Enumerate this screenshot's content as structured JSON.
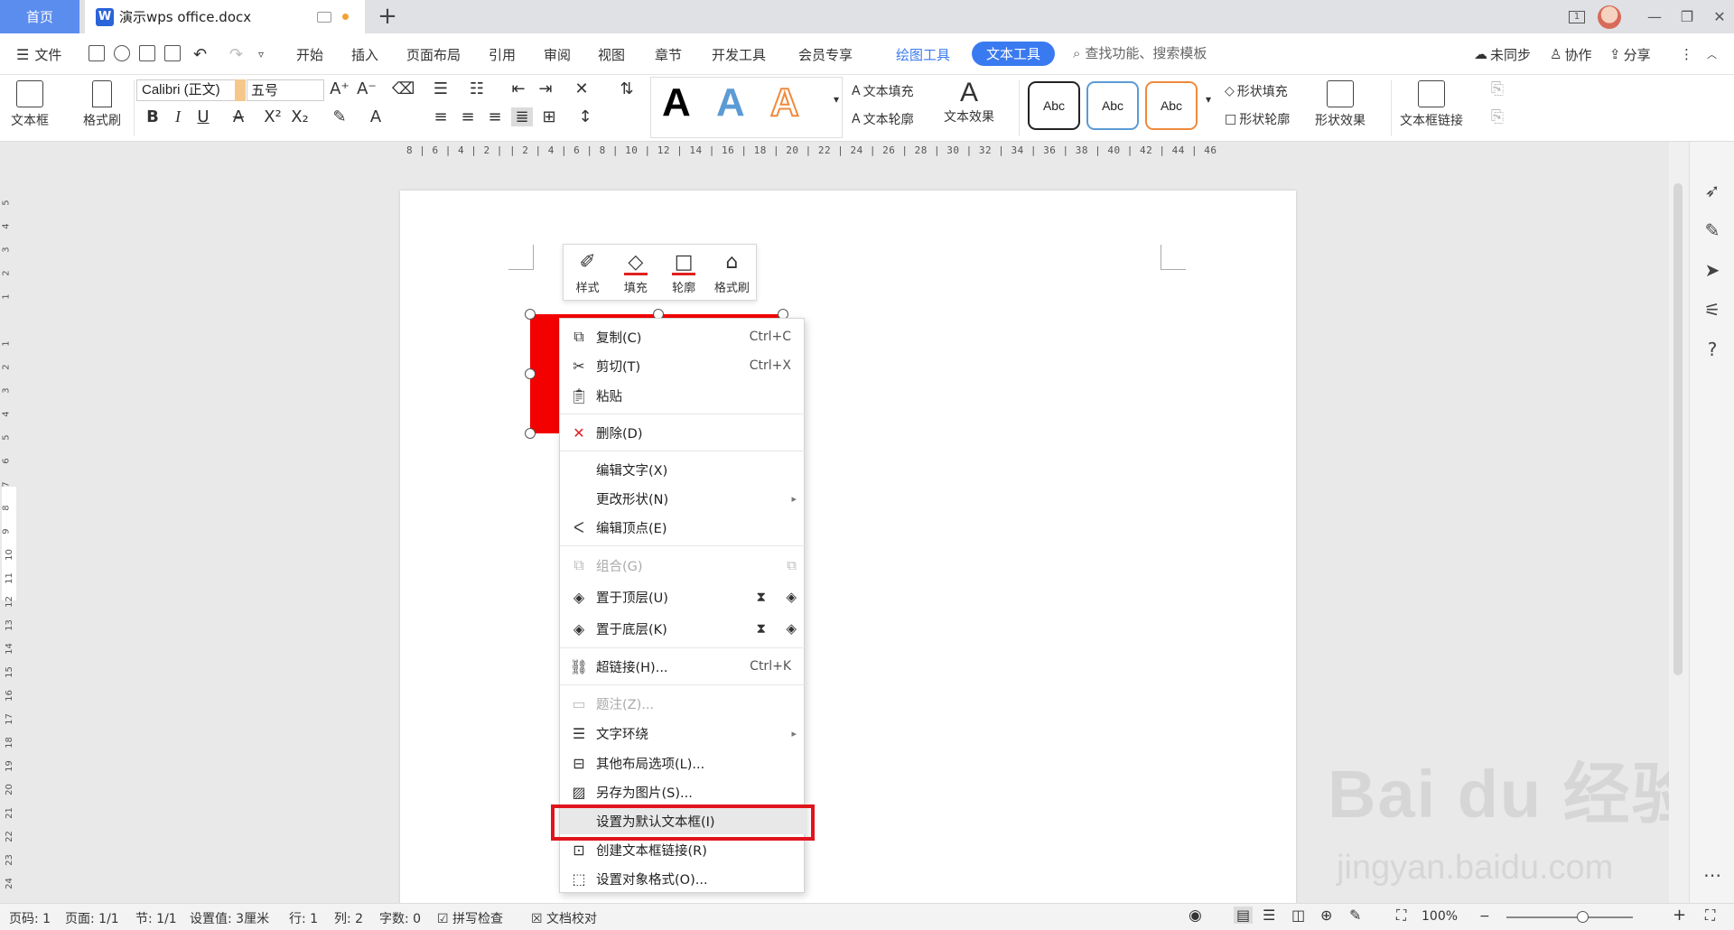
{
  "tabs": {
    "home": "首页",
    "doc_title": "演示wps office.docx"
  },
  "menu": {
    "file": "文件",
    "items": [
      "开始",
      "插入",
      "页面布局",
      "引用",
      "审阅",
      "视图",
      "章节",
      "开发工具",
      "会员专享"
    ],
    "context_tab_drawing": "绘图工具",
    "context_tab_text": "文本工具",
    "search_placeholder": "查找功能、搜索模板",
    "sync": "未同步",
    "collab": "协作",
    "share": "分享"
  },
  "ribbon": {
    "textbox": "文本框",
    "format_painter": "格式刷",
    "font_name": "Calibri (正文)",
    "font_size": "五号",
    "text_fill": "文本填充",
    "text_outline": "文本轮廓",
    "text_effect": "文本效果",
    "abc_label": "Abc",
    "shape_fill": "形状填充",
    "shape_outline": "形状轮廓",
    "shape_effect": "形状效果",
    "textbox_link": "文本框链接"
  },
  "ruler": {
    "ticks": "8 | 6 | 4 | 2 |   | 2 | 4 | 6 | 8 | 10 | 12 | 14 | 16 | 18 | 20 | 22 | 24 | 26 | 28 | 30 | 32 | 34 | 36 | 38 | 40 | 42 | 44 | 46",
    "vertical": [
      "5",
      "4",
      "3",
      "2",
      "1",
      "1",
      "2",
      "3",
      "4",
      "5",
      "6",
      "7",
      "8",
      "9",
      "10",
      "11",
      "12",
      "13",
      "14",
      "15",
      "16",
      "17",
      "18",
      "19",
      "20",
      "21",
      "22",
      "23",
      "24"
    ]
  },
  "mini_toolbar": [
    {
      "label": "样式",
      "icon": "brush-icon"
    },
    {
      "label": "填充",
      "icon": "fill-bucket-icon"
    },
    {
      "label": "轮廓",
      "icon": "outline-icon"
    },
    {
      "label": "格式刷",
      "icon": "format-painter-icon"
    }
  ],
  "context_menu": {
    "copy": "复制(C)",
    "copy_sc": "Ctrl+C",
    "cut": "剪切(T)",
    "cut_sc": "Ctrl+X",
    "paste": "粘贴",
    "delete": "删除(D)",
    "edit_text": "编辑文字(X)",
    "change_shape": "更改形状(N)",
    "edit_points": "编辑顶点(E)",
    "group": "组合(G)",
    "bring_front": "置于顶层(U)",
    "send_back": "置于底层(K)",
    "hyperlink": "超链接(H)...",
    "hyperlink_sc": "Ctrl+K",
    "caption": "题注(Z)...",
    "wrap_text": "文字环绕",
    "layout_options": "其他布局选项(L)...",
    "save_as_picture": "另存为图片(S)...",
    "set_default_textbox": "设置为默认文本框(I)",
    "create_link": "创建文本框链接(R)",
    "format_object": "设置对象格式(O)..."
  },
  "status": {
    "page": "页码: 1",
    "pages": "页面: 1/1",
    "section": "节: 1/1",
    "setting": "设置值: 3厘米",
    "row": "行: 1",
    "col": "列: 2",
    "words": "字数: 0",
    "spell": "拼写检查",
    "proof": "文档校对",
    "zoom": "100%"
  },
  "watermark": {
    "brand": "Bai du 经验",
    "url": "jingyan.baidu.com"
  },
  "colors": {
    "accent": "#3a7af0",
    "shape_fill": "#f30000",
    "highlight": "#e0141c"
  }
}
